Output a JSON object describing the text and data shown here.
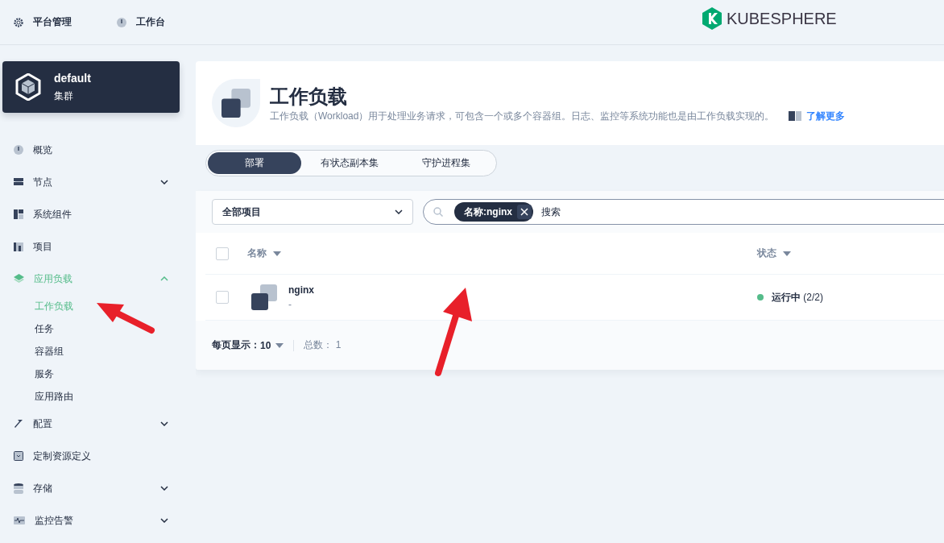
{
  "topbar": {
    "links": [
      {
        "label": "平台管理",
        "selected": false
      },
      {
        "label": "工作台",
        "selected": false
      }
    ],
    "logo": "KUBESPHERE"
  },
  "cluster": {
    "name": "default",
    "type": "集群"
  },
  "nav": [
    {
      "label": "概览",
      "selected": false
    },
    {
      "label": "节点",
      "selected": false,
      "expanded": false
    },
    {
      "label": "系统组件",
      "selected": false
    },
    {
      "label": "项目",
      "selected": false
    },
    {
      "label": "应用负载",
      "selected": true,
      "expanded": true,
      "children": [
        {
          "label": "工作负载",
          "selected": true
        },
        {
          "label": "任务",
          "selected": false
        },
        {
          "label": "容器组",
          "selected": false
        },
        {
          "label": "服务",
          "selected": false
        },
        {
          "label": "应用路由",
          "selected": false
        }
      ]
    },
    {
      "label": "配置",
      "selected": false,
      "expanded": false
    },
    {
      "label": "定制资源定义",
      "selected": false
    },
    {
      "label": "存储",
      "selected": false,
      "expanded": false
    },
    {
      "label": "监控告警",
      "selected": false,
      "expanded": false
    }
  ],
  "header": {
    "title": "工作负载",
    "description": "工作负载（Workload）用于处理业务请求，可包含一个或多个容器组。日志、监控等系统功能也是由工作负载实现的。",
    "link": "了解更多"
  },
  "tabs": [
    {
      "label": "部署",
      "selected": true
    },
    {
      "label": "有状态副本集",
      "selected": false
    },
    {
      "label": "守护进程集",
      "selected": false
    }
  ],
  "filter": {
    "project": "全部项目",
    "tag": "名称:nginx",
    "placeholder": "搜索"
  },
  "table": {
    "columns": [
      "名称",
      "状态"
    ],
    "all_checked": false,
    "rows": [
      {
        "checked": false,
        "name": "nginx",
        "description": "-",
        "status": "运行中",
        "replicas": "(2/2)",
        "color": "#55bc8a"
      }
    ]
  },
  "footer": {
    "page_size_label": "每页显示：",
    "page_size": "10",
    "total": "总数： 1"
  }
}
